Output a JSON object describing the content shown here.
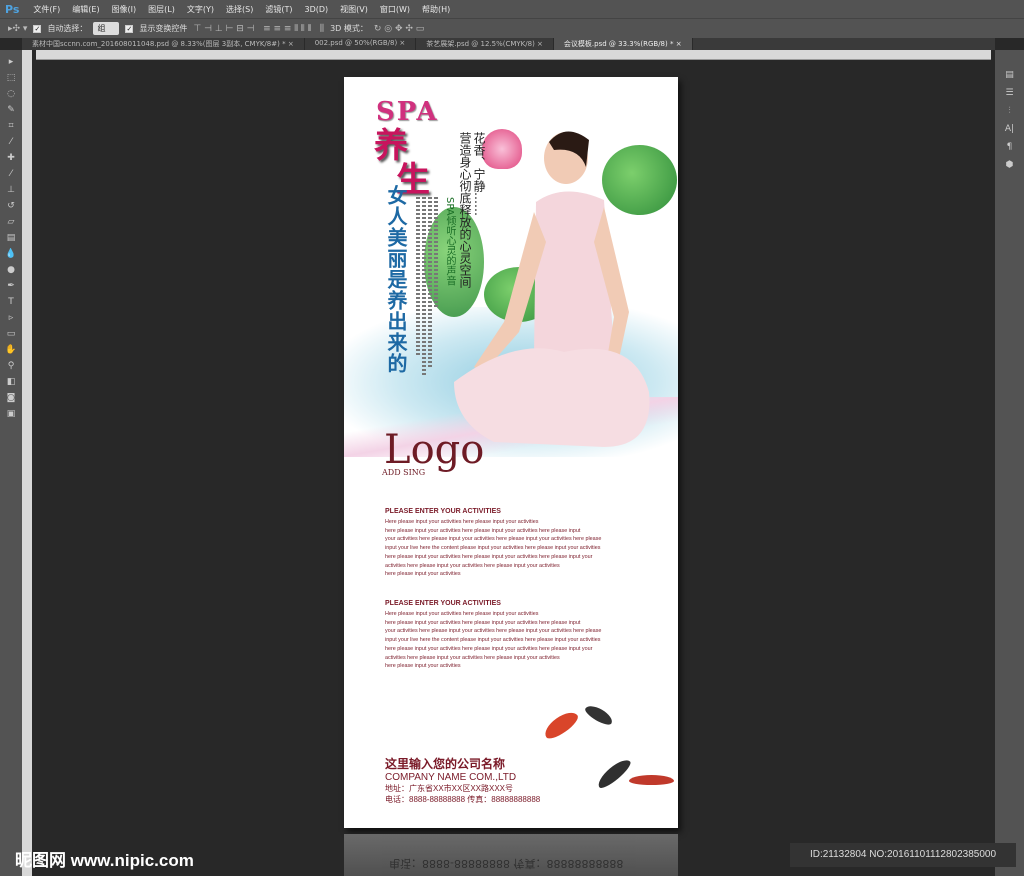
{
  "app": {
    "logo": "Ps"
  },
  "menu": [
    "文件(F)",
    "编辑(E)",
    "图像(I)",
    "图层(L)",
    "文字(Y)",
    "选择(S)",
    "滤镜(T)",
    "3D(D)",
    "视图(V)",
    "窗口(W)",
    "帮助(H)"
  ],
  "options": {
    "auto_select_label": "自动选择：",
    "auto_select_value": "组",
    "show_transform_label": "显示变换控件",
    "mode_3d_label": "3D 模式："
  },
  "tabs": [
    {
      "label": "素材中国sccnn.com_201608011048.psd @ 8.33%(图层 3副本, CMYK/8#) *",
      "close": "×"
    },
    {
      "label": "002.psd @ 50%(RGB/8)",
      "close": "×"
    },
    {
      "label": "茶艺展架.psd @ 12.5%(CMYK/8)",
      "close": "×"
    },
    {
      "label": "会议模板.psd @ 33.3%(RGB/8) *",
      "close": "×"
    }
  ],
  "poster": {
    "spa": "SPA",
    "yangsheng": [
      "养",
      "生"
    ],
    "vertical_title": "女人美丽是养出来的",
    "line1": "花香、宁静……",
    "line2": "营造身心彻底释放的心灵空间",
    "line3": "SPA倾听心灵的声音",
    "logo": "Logo",
    "logo_sub": "ADD SING",
    "blocks": [
      {
        "heading": "PLEASE ENTER YOUR ACTIVITIES",
        "lines": [
          "Here please input your activities here please input your activities",
          "here please input your activities here please input your activities here please input",
          "your activities here please input your activities here please input your activities here please",
          "input your live here the content please input your activities here please input your activities",
          "here please input your activities here please input your activities here please input your",
          " activities here please input your activities here please input your activities",
          "here please input your activities"
        ]
      },
      {
        "heading": "PLEASE ENTER YOUR ACTIVITIES",
        "lines": [
          "Here please input your activities here please input your activities",
          "here please input your activities here please input your activities here please input",
          "your activities here please input your activities here please input your activities here please",
          "input your live here the content please input your activities here please input your activities",
          "here please input your activities here please input your activities here please input your",
          " activities here please input your activities here please input your activities",
          "here please input your activities"
        ]
      }
    ],
    "company_cn": "这里输入您的公司名称",
    "company_en": "COMPANY NAME COM.,LTD",
    "address": "地址：广东省XX市XX区XX路XXX号",
    "phone": "电话：8888-88888888  传真：88888888888"
  },
  "reflection_text": "电话：8888-88888888  传真：88888888888",
  "watermark": "昵图网 www.nipic.com",
  "image_id": "ID:21132804 NO:20161101112802385000",
  "colors": {
    "accent": "#7a1a28",
    "title_blue": "#1d69a4",
    "pink": "#c8145d"
  }
}
